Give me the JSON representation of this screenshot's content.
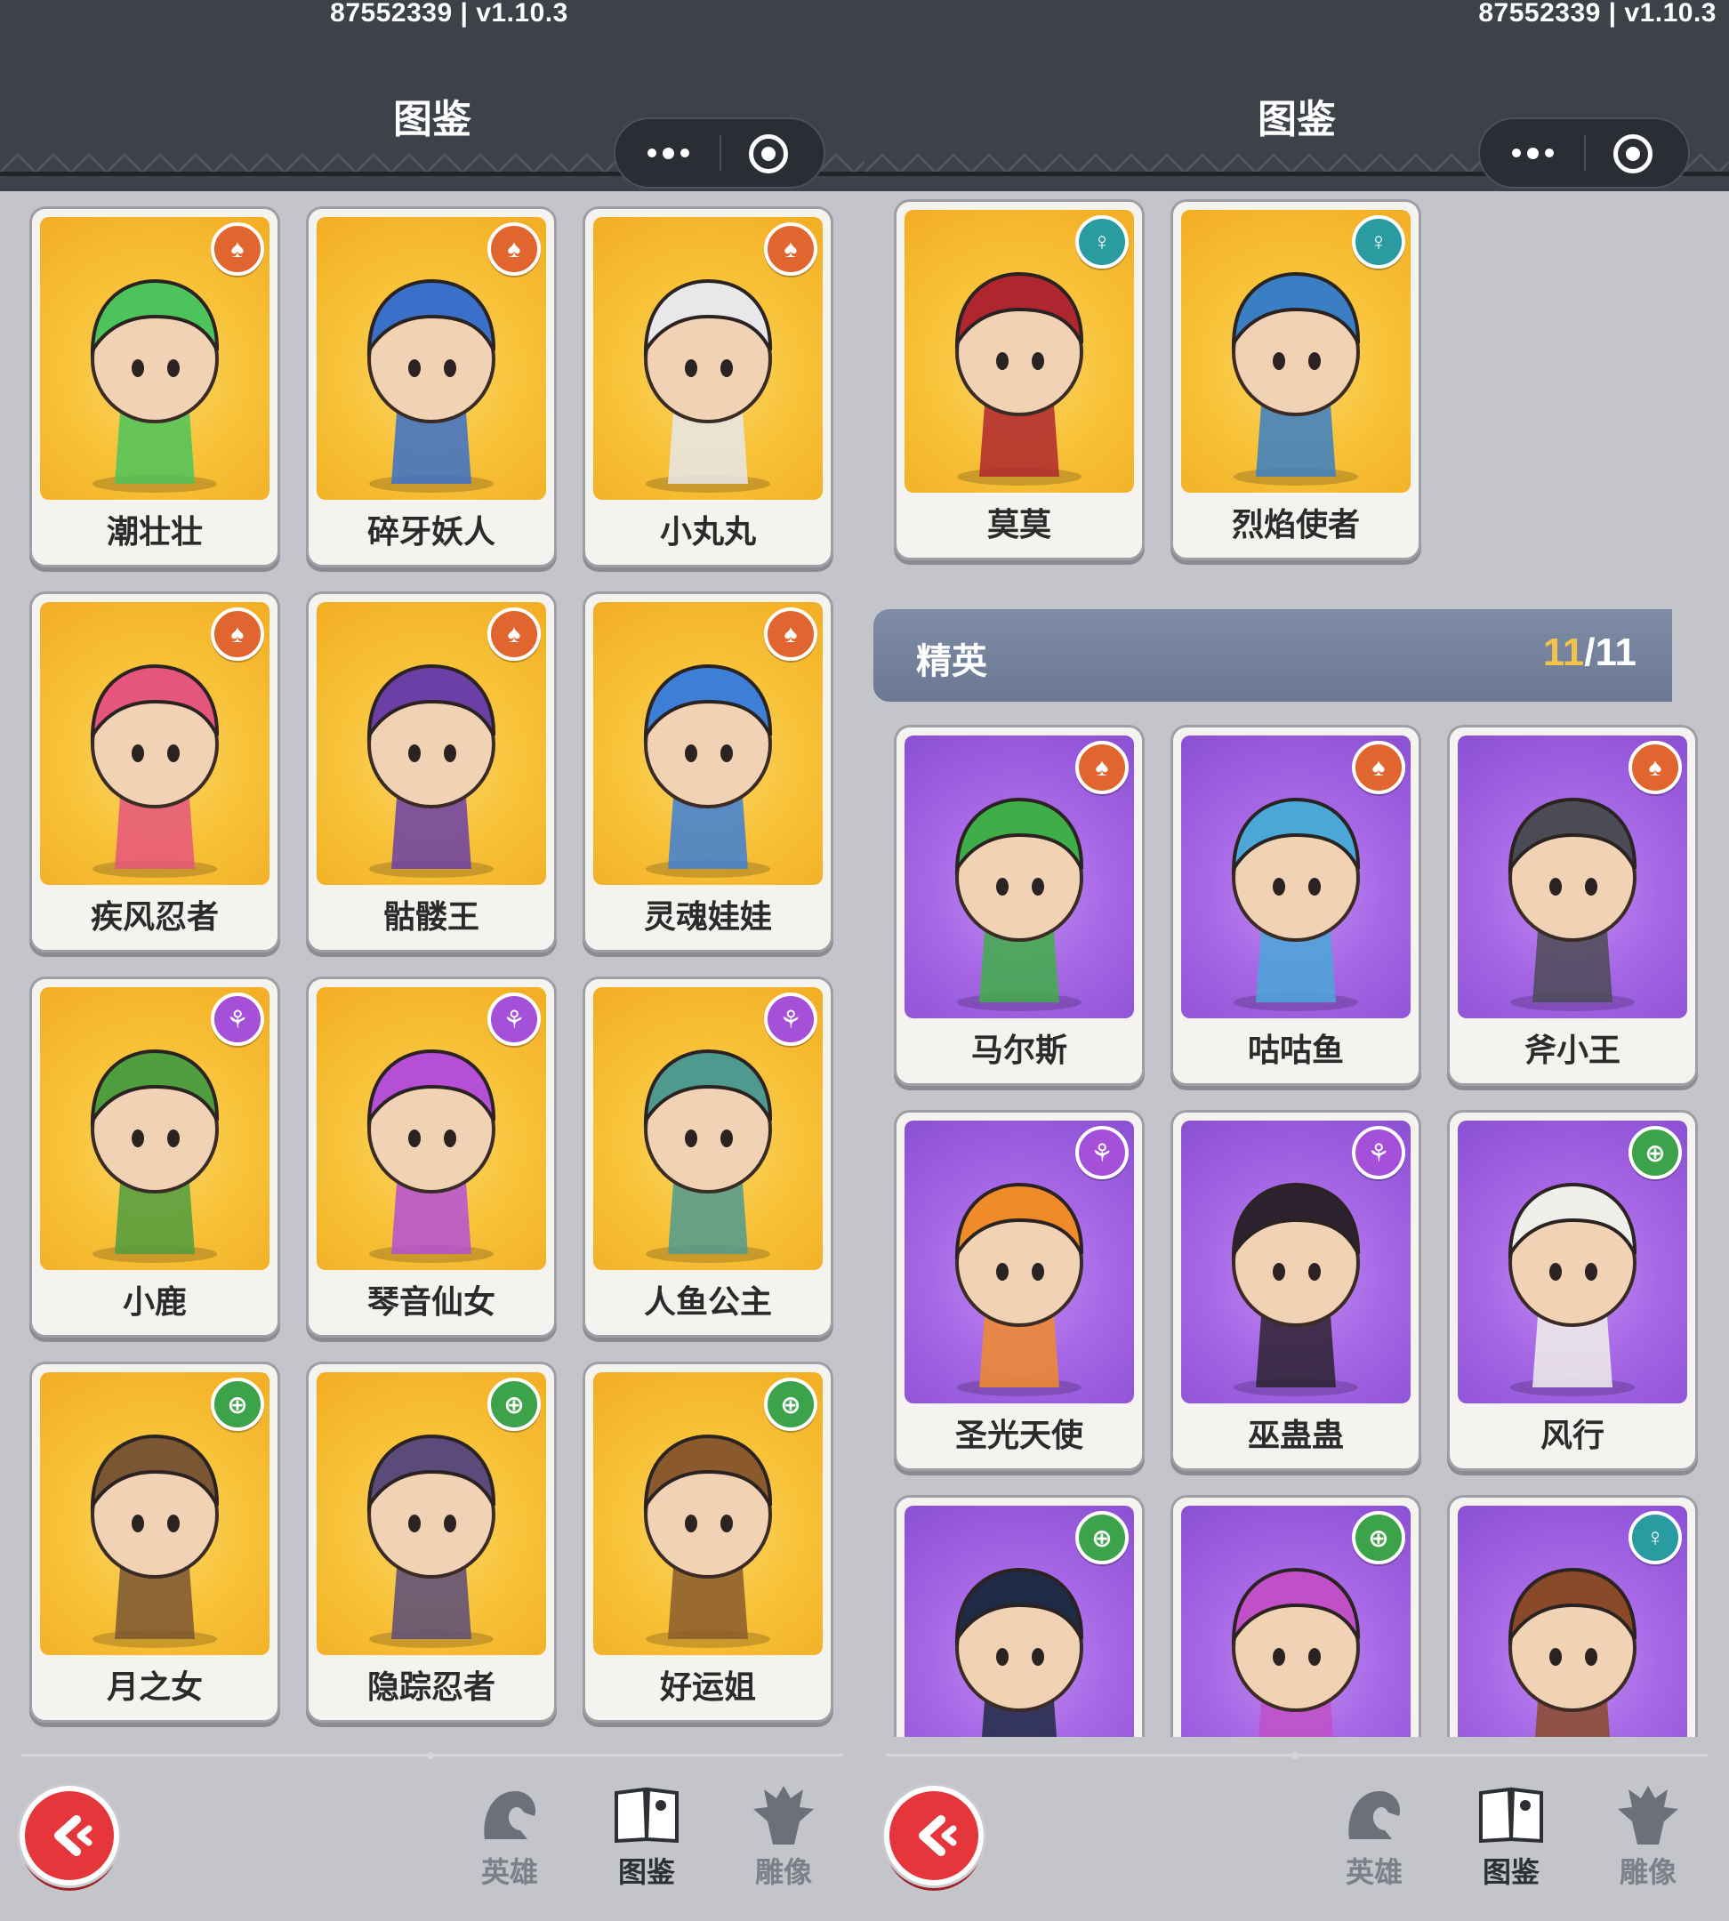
{
  "panels": [
    {
      "version": "87552339 | v1.10.3",
      "title": "图鉴",
      "section": null,
      "cards": [
        {
          "name": "潮壮壮",
          "class": "orange",
          "art": "gold",
          "color": "#4cc35b"
        },
        {
          "name": "碎牙妖人",
          "class": "orange",
          "art": "gold",
          "color": "#3a70c9"
        },
        {
          "name": "小丸丸",
          "class": "orange",
          "art": "gold",
          "color": "#e8e8ea"
        },
        {
          "name": "疾风忍者",
          "class": "orange",
          "art": "gold",
          "color": "#e6557c"
        },
        {
          "name": "骷髅王",
          "class": "orange",
          "art": "gold",
          "color": "#6b3fa6"
        },
        {
          "name": "灵魂娃娃",
          "class": "orange",
          "art": "gold",
          "color": "#3d7fd6"
        },
        {
          "name": "小鹿",
          "class": "purple",
          "art": "gold",
          "color": "#4f9e3e"
        },
        {
          "name": "琴音仙女",
          "class": "purple",
          "art": "gold",
          "color": "#b54fd6"
        },
        {
          "name": "人鱼公主",
          "class": "purple",
          "art": "gold",
          "color": "#4f9a8f"
        },
        {
          "name": "月之女",
          "class": "green",
          "art": "gold",
          "color": "#7a5632"
        },
        {
          "name": "隐踪忍者",
          "class": "green",
          "art": "gold",
          "color": "#5a4b7a"
        },
        {
          "name": "好运姐",
          "class": "green",
          "art": "gold",
          "color": "#8a5a2d"
        }
      ],
      "footer": {
        "nav": [
          "英雄",
          "图鉴",
          "雕像"
        ],
        "active": "图鉴"
      }
    },
    {
      "version": "87552339 | v1.10.3",
      "title": "图鉴",
      "top_cards": [
        {
          "name": "莫莫",
          "class": "teal",
          "art": "gold",
          "color": "#b0262f"
        },
        {
          "name": "烈焰使者",
          "class": "teal",
          "art": "gold",
          "color": "#3a7fc4"
        }
      ],
      "section": {
        "label": "精英",
        "owned": "11",
        "total": "/11"
      },
      "cards": [
        {
          "name": "马尔斯",
          "class": "orange",
          "art": "purple",
          "color": "#3fae48"
        },
        {
          "name": "咕咕鱼",
          "class": "orange",
          "art": "purple",
          "color": "#4aa7d8"
        },
        {
          "name": "斧小王",
          "class": "orange",
          "art": "purple",
          "color": "#4b4b55"
        },
        {
          "name": "圣光天使",
          "class": "purple",
          "art": "purple",
          "color": "#f08b2a"
        },
        {
          "name": "巫蛊蛊",
          "class": "purple",
          "art": "purple",
          "color": "#2d2230"
        },
        {
          "name": "风行",
          "class": "green",
          "art": "purple",
          "color": "#f0f0ea"
        },
        {
          "name": "",
          "class": "green",
          "art": "purple",
          "color": "#1f2a44"
        },
        {
          "name": "",
          "class": "green",
          "art": "purple",
          "color": "#c150c8"
        },
        {
          "name": "",
          "class": "teal",
          "art": "purple",
          "color": "#8a4a2a"
        }
      ],
      "footer": {
        "nav": [
          "英雄",
          "图鉴",
          "雕像"
        ],
        "active": "图鉴"
      }
    }
  ],
  "class_icons": {
    "orange": "fist-icon",
    "purple": "potion-icon",
    "green": "shield-icon",
    "teal": "key-icon"
  }
}
